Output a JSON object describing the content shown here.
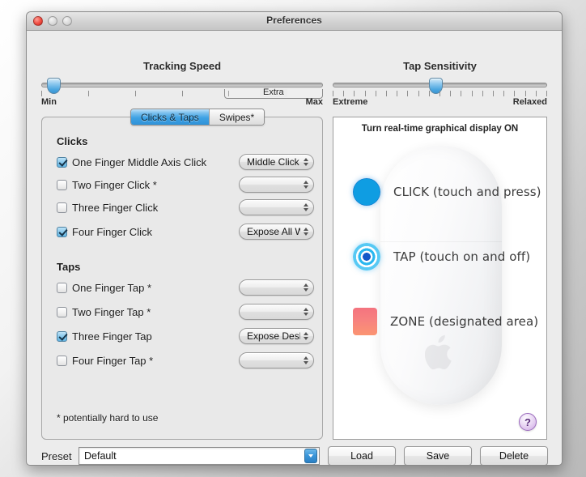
{
  "window": {
    "title": "Preferences",
    "traffic_lights": [
      "close",
      "minimize",
      "zoom"
    ]
  },
  "tracking_speed": {
    "title": "Tracking Speed",
    "min_label": "Min",
    "max_label": "Max",
    "extra_label": "Extra",
    "value_percent": 2,
    "tick_count": 7,
    "extra_start_percent": 65,
    "extra_end_percent": 100
  },
  "tap_sensitivity": {
    "title": "Tap Sensitivity",
    "min_label": "Extreme",
    "max_label": "Relaxed",
    "value_percent": 48,
    "tick_count": 21
  },
  "tabs": [
    {
      "label": "Clicks & Taps",
      "active": true
    },
    {
      "label": "Swipes*",
      "active": false
    }
  ],
  "clicks": {
    "heading": "Clicks",
    "rows": [
      {
        "label": "One Finger Middle Axis Click",
        "checked": true,
        "action": "Middle Click"
      },
      {
        "label": "Two Finger Click *",
        "checked": false,
        "action": ""
      },
      {
        "label": "Three Finger Click",
        "checked": false,
        "action": ""
      },
      {
        "label": "Four Finger Click",
        "checked": true,
        "action": "Expose All W..."
      }
    ]
  },
  "taps": {
    "heading": "Taps",
    "rows": [
      {
        "label": "One Finger Tap *",
        "checked": false,
        "action": ""
      },
      {
        "label": "Two Finger Tap *",
        "checked": false,
        "action": ""
      },
      {
        "label": "Three Finger Tap",
        "checked": true,
        "action": "Expose Desk..."
      },
      {
        "label": "Four Finger Tap *",
        "checked": false,
        "action": ""
      }
    ]
  },
  "footnote": "* potentially hard to use",
  "graphic_panel": {
    "title": "Turn real-time graphical display ON",
    "legend": [
      {
        "icon": "blue-filled-circle",
        "text": "CLICK (touch and press)"
      },
      {
        "icon": "concentric-target",
        "text": "TAP (touch on and off)"
      },
      {
        "icon": "pink-square",
        "text": "ZONE (designated area)"
      }
    ],
    "help_label": "?"
  },
  "bottom_bar": {
    "preset_label": "Preset",
    "preset_value": "Default",
    "preset_placeholder": "Default",
    "buttons": [
      {
        "label": "Load"
      },
      {
        "label": "Save"
      },
      {
        "label": "Delete"
      }
    ]
  },
  "colors": {
    "accent_blue": "#3b97da",
    "click_blue": "#0f9de2",
    "tap_cyan": "#57c9f4",
    "zone_pink": "#f7827f",
    "help_purple": "#9b6bbd",
    "window_bg": "#ececec"
  }
}
